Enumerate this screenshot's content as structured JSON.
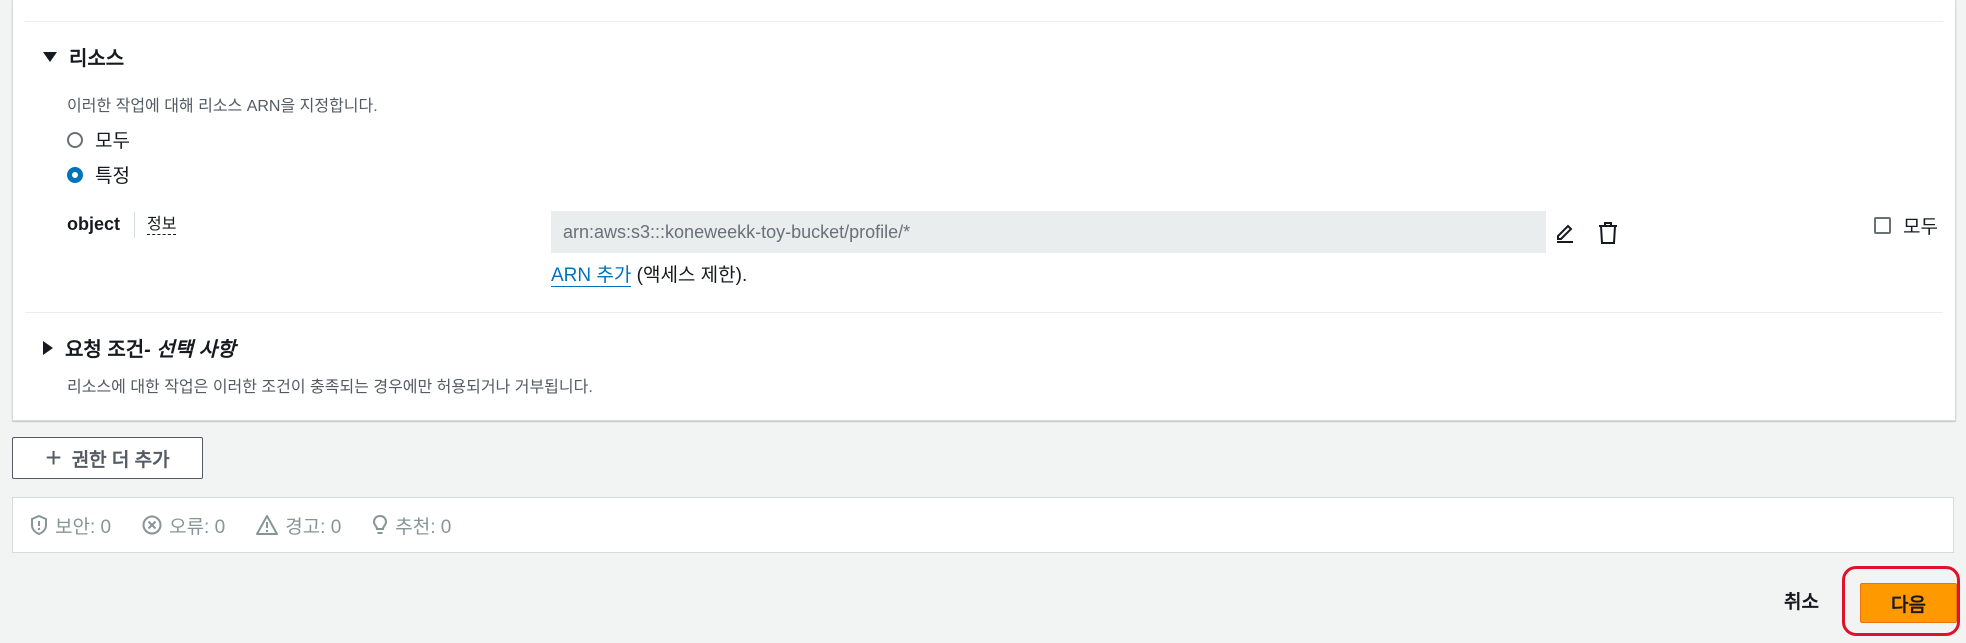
{
  "resources": {
    "heading": "리소스",
    "description": "이러한 작업에 대해 리소스 ARN을 지정합니다.",
    "radio_all": "모두",
    "radio_specific": "특정",
    "selected": "특정",
    "object_label": "object",
    "info_link": "정보",
    "arn_value": "arn:aws:s3:::koneweekk-toy-bucket/profile/*",
    "add_arn_link": "ARN 추가",
    "add_arn_suffix": " (액세스 제한).",
    "all_checkbox_label": "모두"
  },
  "conditions": {
    "heading": "요청 조건",
    "heading_optional": " - 선택 사항",
    "description": "리소스에 대한 작업은 이러한 조건이 충족되는 경우에만 허용되거나 거부됩니다."
  },
  "add_permissions_button": "권한 더 추가",
  "status": {
    "security": "보안: 0",
    "errors": "오류: 0",
    "warnings": "경고: 0",
    "suggestions": "추천: 0"
  },
  "footer": {
    "cancel": "취소",
    "next": "다음"
  },
  "colors": {
    "primary": "#ff9900",
    "link": "#0073bb",
    "highlight": "#e0112b"
  }
}
